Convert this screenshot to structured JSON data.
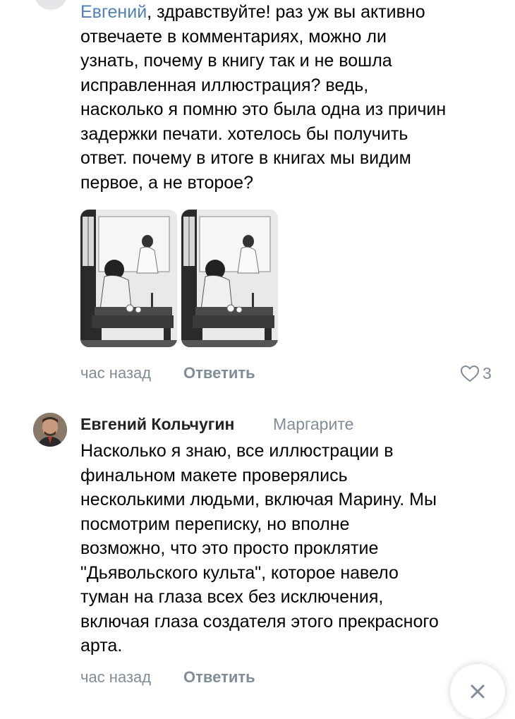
{
  "comment1": {
    "mention": "Евгений",
    "text_rest": ", здравствуйте! раз уж вы активно\nотвечаете в комментариях, можно ли\nузнать, почему в книгу так и не вошла\nисправленная иллюстрация? ведь,\nнасколько я помню это была одна из причин\nзадержки печати. хотелось бы получить\nответ. почему в итоге в книгах мы видим\nпервое, а не второе?",
    "time": "час назад",
    "reply_label": "Ответить",
    "likes_count": "3"
  },
  "comment2": {
    "author": "Евгений Кольчугин",
    "reply_to": "Маргарите",
    "text": "Насколько я знаю, все иллюстрации в\nфинальном макете проверялись\nнесколькими людьми, включая Марину. Мы\nпосмотрим переписку, но вполне\nвозможно, что это просто проклятие\n\"Дьявольского культа\", которое навело\nтуман на глаза всех без исключения,\nвключая глаза создателя этого прекрасного\nарта.",
    "time": "час назад",
    "reply_label": "Ответить"
  },
  "icons": {
    "likes": "heart-icon",
    "close": "close-icon",
    "avatar": "user-avatar"
  },
  "colors": {
    "link": "#5181b8",
    "secondary": "#818c99"
  }
}
